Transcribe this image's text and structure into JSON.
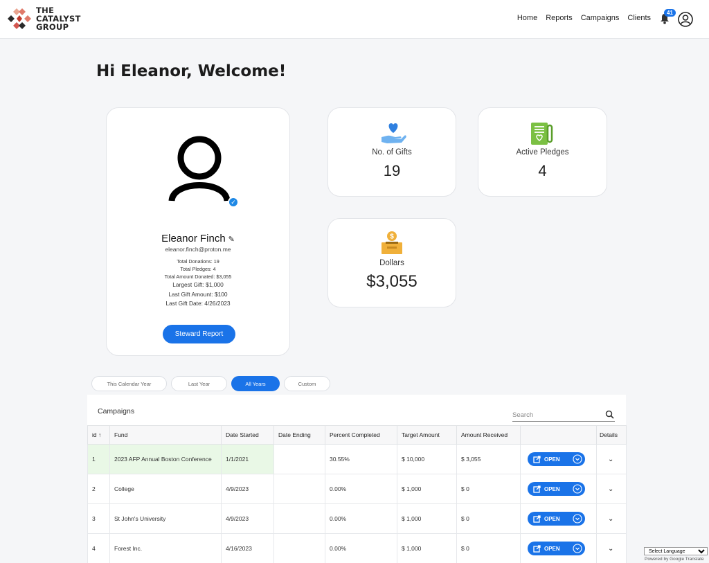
{
  "brand": {
    "line1": "THE",
    "line2": "CATALYST",
    "line3": "GROUP"
  },
  "nav": [
    "Home",
    "Reports",
    "Campaigns",
    "Clients"
  ],
  "notifications": {
    "count": "41"
  },
  "welcome": "Hi Eleanor, Welcome!",
  "profile": {
    "name": "Eleanor Finch",
    "email": "eleanor.finch@proton.me",
    "stats_small": [
      "Total Donations: 19",
      "Total Pledges: 4",
      "Total Amount Donated: $3,055"
    ],
    "stats_big": [
      "Largest Gift: $1,000",
      "Last Gift Amount: $100",
      "Last Gift Date: 4/26/2023"
    ],
    "report_button": "Steward Report"
  },
  "cards": {
    "gifts": {
      "label": "No. of Gifts",
      "value": "19"
    },
    "pledges": {
      "label": "Active Pledges",
      "value": "4"
    },
    "dollars": {
      "label": "Dollars",
      "value": "$3,055"
    }
  },
  "filters": [
    "This Calendar Year",
    "Last Year",
    "All Years",
    "Custom"
  ],
  "active_filter": "All Years",
  "campaigns": {
    "title": "Campaigns",
    "search_placeholder": "Search",
    "columns": [
      "id",
      "Fund",
      "Date Started",
      "Date Ending",
      "Percent Completed",
      "Target Amount",
      "Amount Received",
      "",
      "Details"
    ],
    "open_label": "OPEN",
    "rows": [
      {
        "id": "1",
        "fund": "2023 AFP Annual Boston Conference",
        "started": "1/1/2021",
        "ending": "",
        "percent": "30.55%",
        "target": "$ 10,000",
        "received": "$ 3,055"
      },
      {
        "id": "2",
        "fund": "College",
        "started": "4/9/2023",
        "ending": "",
        "percent": "0.00%",
        "target": "$ 1,000",
        "received": "$ 0"
      },
      {
        "id": "3",
        "fund": "St John's University",
        "started": "4/9/2023",
        "ending": "",
        "percent": "0.00%",
        "target": "$ 1,000",
        "received": "$ 0"
      },
      {
        "id": "4",
        "fund": "Forest Inc.",
        "started": "4/16/2023",
        "ending": "",
        "percent": "0.00%",
        "target": "$ 1,000",
        "received": "$ 0"
      }
    ]
  },
  "translate": {
    "select_label": "Select Language",
    "powered": "Powered by Google Translate"
  },
  "colors": {
    "accent": "#1a73e8",
    "highlight": "#e9f8e6"
  }
}
